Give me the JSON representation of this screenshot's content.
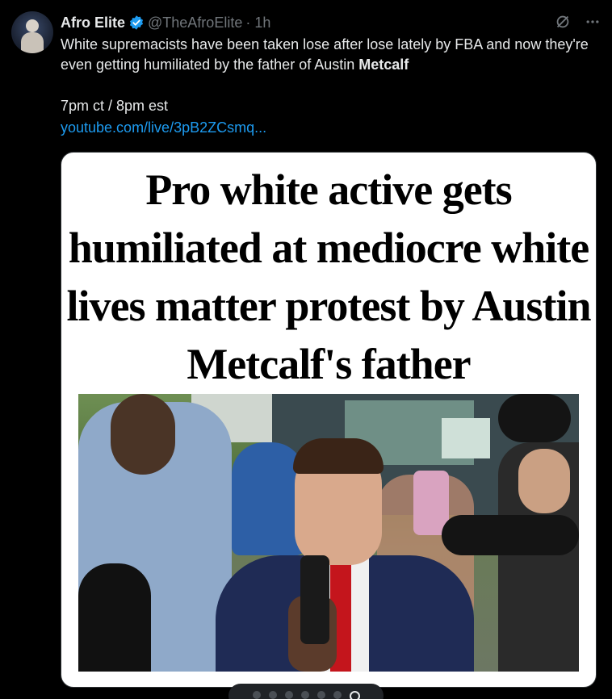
{
  "author": {
    "name": "Afro Elite",
    "handle": "@TheAfroElite",
    "time": "· 1h"
  },
  "tweet": {
    "text_main": "White supremacists have been taken lose after lose lately by FBA and now they're even getting humiliated by the father of Austin ",
    "text_bold": "Metcalf",
    "line3": "7pm ct / 8pm est",
    "link": "youtube.com/live/3pB2ZCsmq..."
  },
  "card": {
    "headline": "Pro white active gets humiliated at mediocre white lives matter protest by Austin Metcalf's father"
  },
  "icons": {
    "verified": "verified-badge-icon",
    "grok": "grok-icon",
    "more": "more-icon"
  },
  "colors": {
    "accent": "#1d9bf0",
    "text": "#e7e9ea",
    "muted": "#71767b",
    "background": "#000000"
  },
  "pager": {
    "count": 7,
    "active_index": 6
  }
}
